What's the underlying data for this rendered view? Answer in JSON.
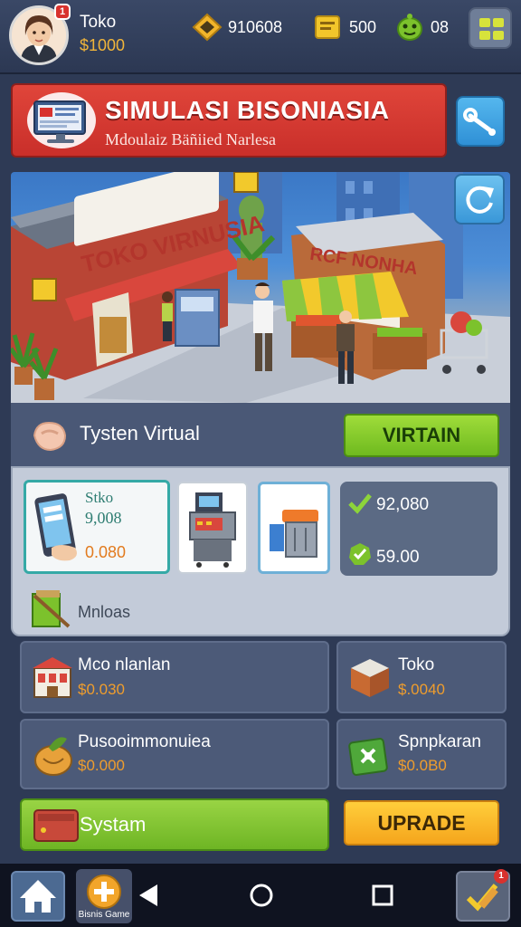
{
  "player": {
    "name": "Toko",
    "money": "$1000",
    "notifications": "1"
  },
  "resources": [
    {
      "icon": "diamond-coin-icon",
      "value": "910608"
    },
    {
      "icon": "cash-bill-icon",
      "value": "500"
    },
    {
      "icon": "green-mascot-icon",
      "value": "08"
    }
  ],
  "banner": {
    "title": "SIMULASI BISONIASIA",
    "subtitle": "Mdoulaiz Bäñiied Narlesa"
  },
  "scene": {
    "store_sign": "TOKO VIRNUSIA",
    "stall_sign": "RCF NONHA"
  },
  "system_bar": {
    "label": "Tysten Virtual",
    "button": "VIRTAIN"
  },
  "cards": {
    "phone_card": {
      "title": "Stko",
      "value": "9,008",
      "price": "0.080"
    },
    "stats": [
      {
        "icon": "check-icon",
        "value": "92,080"
      },
      {
        "icon": "badge-check-icon",
        "value": "59.00"
      }
    ],
    "maintenance_label": "Mnloas"
  },
  "businesses": [
    {
      "icon": "shop-building-icon",
      "name": "Mco nlanlan",
      "price": "$0.030"
    },
    {
      "icon": "toko-box-icon",
      "name": "Toko",
      "price": "$.0040"
    },
    {
      "icon": "produce-bag-icon",
      "name": "Pusooimmonuiea",
      "price": "$0.000"
    },
    {
      "icon": "green-gear-icon",
      "name": "Spnpkaran",
      "price": "$0.0B0"
    }
  ],
  "actions": {
    "system": "Systam",
    "upgrade": "UPRADE"
  },
  "nav": {
    "game_label": "Bisnis Game",
    "tasks_badge": "1"
  },
  "colors": {
    "accent_red": "#d8322e",
    "accent_green": "#7cc22c",
    "accent_yellow": "#f9b826",
    "background": "#2e3a55"
  }
}
